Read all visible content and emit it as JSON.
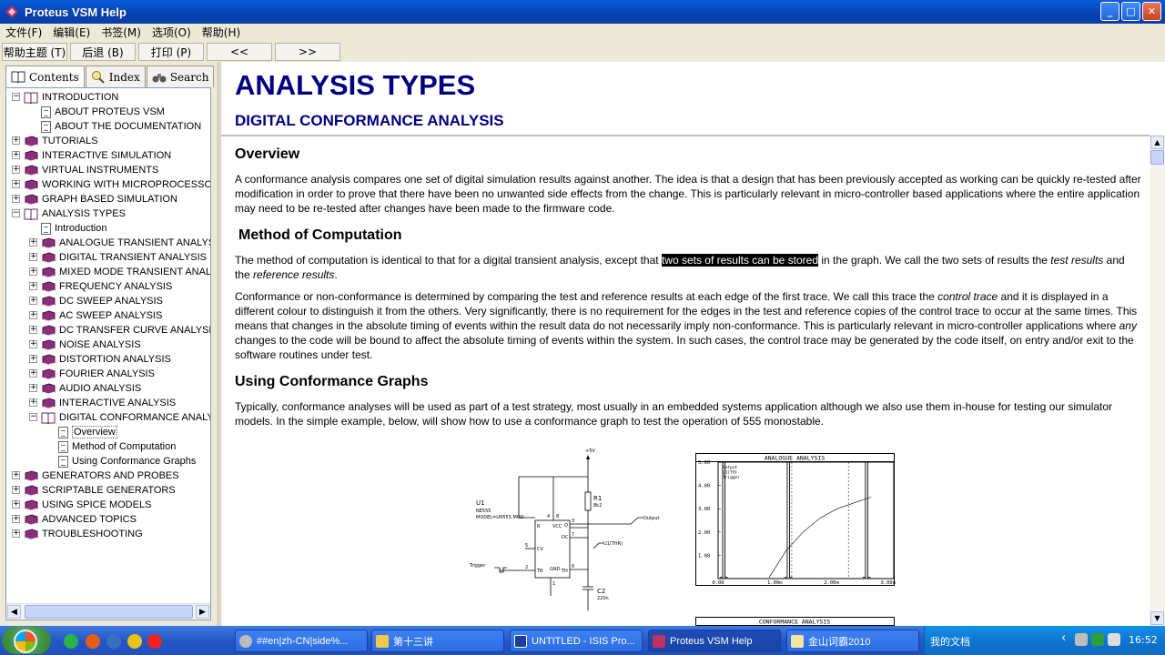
{
  "window": {
    "title": "Proteus VSM Help"
  },
  "menu": [
    "文件(F)",
    "编辑(E)",
    "书签(M)",
    "选项(O)",
    "帮助(H)"
  ],
  "toolbar": {
    "help_topics": "帮助主题 (T)",
    "back": "后退 (B)",
    "print": "打印 (P)",
    "prev": "<<",
    "next": ">>"
  },
  "tabs": {
    "contents": "Contents",
    "index": "Index",
    "search": "Search"
  },
  "tree": [
    {
      "label": "INTRODUCTION",
      "level": 0,
      "type": "book-open",
      "expander": "−"
    },
    {
      "label": "ABOUT PROTEUS VSM",
      "level": 1,
      "type": "page"
    },
    {
      "label": "ABOUT THE DOCUMENTATION",
      "level": 1,
      "type": "page"
    },
    {
      "label": "TUTORIALS",
      "level": 0,
      "type": "book",
      "expander": "+"
    },
    {
      "label": "INTERACTIVE SIMULATION",
      "level": 0,
      "type": "book",
      "expander": "+"
    },
    {
      "label": "VIRTUAL INSTRUMENTS",
      "level": 0,
      "type": "book",
      "expander": "+"
    },
    {
      "label": "WORKING WITH MICROPROCESSORS",
      "level": 0,
      "type": "book",
      "expander": "+"
    },
    {
      "label": "GRAPH BASED SIMULATION",
      "level": 0,
      "type": "book",
      "expander": "+"
    },
    {
      "label": "ANALYSIS TYPES",
      "level": 0,
      "type": "book-open",
      "expander": "−"
    },
    {
      "label": "Introduction",
      "level": 1,
      "type": "page"
    },
    {
      "label": "ANALOGUE TRANSIENT ANALYSIS",
      "level": 1,
      "type": "book",
      "expander": "+"
    },
    {
      "label": "DIGITAL TRANSIENT ANALYSIS",
      "level": 1,
      "type": "book",
      "expander": "+"
    },
    {
      "label": "MIXED MODE TRANSIENT ANALYSIS",
      "level": 1,
      "type": "book",
      "expander": "+"
    },
    {
      "label": "FREQUENCY ANALYSIS",
      "level": 1,
      "type": "book",
      "expander": "+"
    },
    {
      "label": "DC SWEEP ANALYSIS",
      "level": 1,
      "type": "book",
      "expander": "+"
    },
    {
      "label": "AC SWEEP ANALYSIS",
      "level": 1,
      "type": "book",
      "expander": "+"
    },
    {
      "label": "DC TRANSFER CURVE ANALYSIS",
      "level": 1,
      "type": "book",
      "expander": "+"
    },
    {
      "label": "NOISE ANALYSIS",
      "level": 1,
      "type": "book",
      "expander": "+"
    },
    {
      "label": "DISTORTION ANALYSIS",
      "level": 1,
      "type": "book",
      "expander": "+"
    },
    {
      "label": "FOURIER ANALYSIS",
      "level": 1,
      "type": "book",
      "expander": "+"
    },
    {
      "label": "AUDIO ANALYSIS",
      "level": 1,
      "type": "book",
      "expander": "+"
    },
    {
      "label": "INTERACTIVE ANALYSIS",
      "level": 1,
      "type": "book",
      "expander": "+"
    },
    {
      "label": "DIGITAL CONFORMANCE ANALYSIS",
      "level": 1,
      "type": "book-open",
      "expander": "−"
    },
    {
      "label": "Overview",
      "level": 2,
      "type": "page",
      "selected": true
    },
    {
      "label": "Method of Computation",
      "level": 2,
      "type": "page"
    },
    {
      "label": "Using Conformance Graphs",
      "level": 2,
      "type": "page"
    },
    {
      "label": "GENERATORS AND PROBES",
      "level": 0,
      "type": "book",
      "expander": "+"
    },
    {
      "label": "SCRIPTABLE GENERATORS",
      "level": 0,
      "type": "book",
      "expander": "+"
    },
    {
      "label": "USING SPICE MODELS",
      "level": 0,
      "type": "book",
      "expander": "+"
    },
    {
      "label": "ADVANCED TOPICS",
      "level": 0,
      "type": "book",
      "expander": "+"
    },
    {
      "label": "TROUBLESHOOTING",
      "level": 0,
      "type": "book",
      "expander": "+"
    }
  ],
  "content": {
    "title": "ANALYSIS TYPES",
    "subtitle": "DIGITAL CONFORMANCE ANALYSIS",
    "overview_heading": "Overview",
    "overview_text": "A conformance analysis compares one set of digital simulation results against another. The idea is that a design that has been previously accepted as working can be quickly re-tested after modification in order to prove that there have been no unwanted side effects from the change. This is particularly relevant in micro-controller based applications where the entire application may need to be re-tested after changes have been made to the firmware code.",
    "method_heading": "Method of Computation",
    "method_text_1a": "The method of computation is identical to that for a digital transient analysis, except that ",
    "method_text_1_sel": "two sets of results can be stored",
    "method_text_1b": " in the graph. We call the two sets of results the ",
    "method_text_1_it1": "test results",
    "method_text_1c": " and the ",
    "method_text_1_it2": "reference results",
    "method_text_1d": ".",
    "method_text_2a": "Conformance or non-conformance is determined by comparing the test and reference results at each edge of the first trace. We call this trace the ",
    "method_text_2_it1": "control trace",
    "method_text_2b": " and it is displayed in a different colour to distinguish it from the others. Very significantly, there is no requirement for the edges in the test and reference copies of the control trace to occur at the same times. This means that changes in the absolute timing of events within the result data do not necessarily imply non-conformance. This is particularly relevant in micro-controller applications where ",
    "method_text_2_it2": "any",
    "method_text_2c": " changes to the code will be bound to affect the absolute timing of events within the system. In such cases, the control trace may be generated by the code itself, on entry and/or exit to the software routines under test.",
    "using_heading": "Using Conformance Graphs",
    "using_text": "Typically, conformance analyses will be used as part of a  test strategy, most usually in an embedded systems application although we also use them in-house for testing our simulator models. In the simple example, below, will show how to use a conformance graph to test the operation of 555 monostable."
  },
  "schematic": {
    "supply": "+5V",
    "u1": "U1",
    "u1_part": "NE555",
    "u1_model": "MODEL=LM555.MOD",
    "r1": "R1",
    "r1_val": "8k2",
    "c2": "C2",
    "c2_val": "220n",
    "output": "Output",
    "trigger": "Trigger",
    "uthr": "U1(THR)",
    "pin_r": "R",
    "pin_vcc": "VCC",
    "pin_dc": "DC",
    "pin_cv": "CV",
    "pin_q": "Q",
    "pin_tr": "TR",
    "pin_gnd": "GND",
    "pin_th": "TH",
    "pin4": "4",
    "pin8": "8",
    "pin3": "3",
    "pin7": "7",
    "pin5": "5",
    "pin2": "2",
    "pin1": "1",
    "pin6": "6"
  },
  "chart_data": [
    {
      "type": "line",
      "title": "ANALOGUE ANALYSIS",
      "legend": [
        "Output",
        "U1(TH)",
        "Trigger"
      ],
      "ylim": [
        0,
        5
      ],
      "yticks": [
        "5.00",
        "4.00",
        "3.00",
        "2.00",
        "1.00"
      ],
      "xticks": [
        "0.00",
        "1.00m",
        "2.00m",
        "3.00m"
      ],
      "series": [
        {
          "name": "U1(TH)",
          "x": [
            0.9,
            1.2,
            1.5,
            1.8,
            2.1,
            2.4,
            2.7
          ],
          "y": [
            0.05,
            1.2,
            2.0,
            2.6,
            3.0,
            3.25,
            3.5
          ]
        }
      ]
    },
    {
      "type": "line",
      "title": "CONFORMANCE ANALYSIS"
    }
  ],
  "taskbar": {
    "tasks": [
      "##en|zh-CN|side%...",
      "第十三讲",
      "UNTITLED - ISIS Pro...",
      "Proteus VSM Help",
      "金山词霸2010"
    ],
    "my_docs": "我的文档",
    "clock": "16:52"
  },
  "colors": {
    "heading": "#000080",
    "titlebar": "#0542B4",
    "taskbar": "#2457C5"
  }
}
